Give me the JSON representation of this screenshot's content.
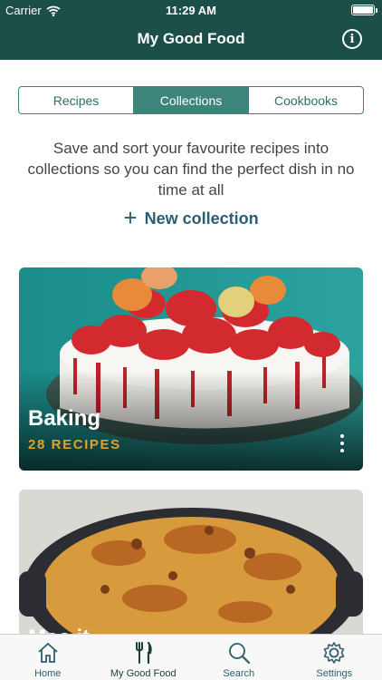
{
  "status_bar": {
    "carrier": "Carrier",
    "time": "11:29 AM"
  },
  "nav": {
    "title": "My Good Food",
    "info_icon": "info-icon"
  },
  "segments": [
    {
      "label": "Recipes",
      "active": false
    },
    {
      "label": "Collections",
      "active": true
    },
    {
      "label": "Cookbooks",
      "active": false
    }
  ],
  "intro_text": "Save and sort your favourite recipes into collections so you can find the perfect dish in no time at all",
  "new_collection": {
    "label": "New collection",
    "icon": "plus-icon"
  },
  "collections": [
    {
      "title": "Baking",
      "count": "28 RECIPES"
    },
    {
      "title": "Mac it..."
    }
  ],
  "tabbar": [
    {
      "label": "Home",
      "icon": "home-icon",
      "active": false
    },
    {
      "label": "My Good Food",
      "icon": "fork-knife-icon",
      "active": true
    },
    {
      "label": "Search",
      "icon": "search-icon",
      "active": false
    },
    {
      "label": "Settings",
      "icon": "gear-icon",
      "active": false
    }
  ],
  "colors": {
    "header": "#1c4f47",
    "accent": "#3d857b",
    "link": "#2a5e73",
    "count": "#e0a12e"
  }
}
